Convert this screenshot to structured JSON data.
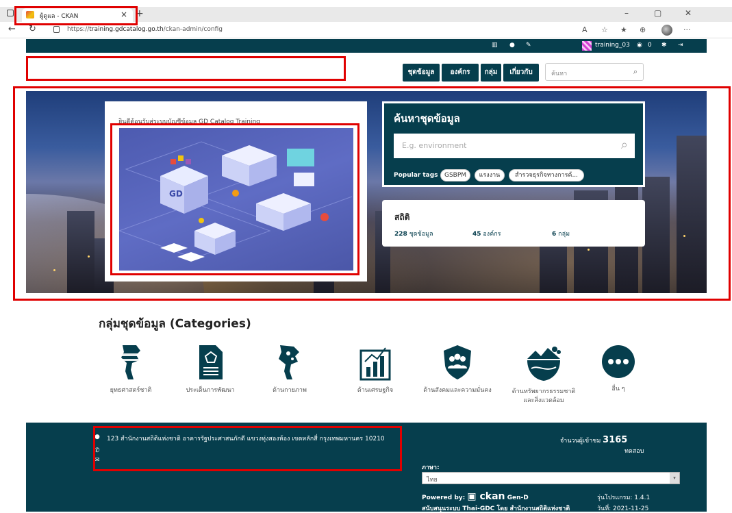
{
  "browser": {
    "tab_title": "ผู้ดูแล - CKAN",
    "url_prefix": "https://",
    "url_host": "training.gdcatalog.go.th",
    "url_path": "/ckan-admin/config"
  },
  "topbar": {
    "username": "training_03",
    "activity_count": "0"
  },
  "nav": {
    "items": [
      "ชุดข้อมูล",
      "องค์กร",
      "กลุ่ม",
      "เกี่ยวกับ"
    ],
    "search_placeholder": "ค้นหา"
  },
  "hero": {
    "welcome_text": "ยินดีต้อนรับสู่ระบบบัญชีข้อมูล GD Catalog Training",
    "search_title": "ค้นหาชุดข้อมูล",
    "search_placeholder": "E.g. environment",
    "popular_tags_label": "Popular tags",
    "tags": [
      "GSBPM",
      "แรงงาน",
      "สำรวจธุรกิจทางการค้..."
    ],
    "illustration_text": "GD"
  },
  "stats": {
    "title": "สถิติ",
    "datasets_count": "228",
    "datasets_label": "ชุดข้อมูล",
    "orgs_count": "45",
    "orgs_label": "องค์กร",
    "groups_count": "6",
    "groups_label": "กลุ่ม"
  },
  "categories": {
    "title": "กลุ่มชุดข้อมูล (Categories)",
    "items": [
      {
        "label": "ยุทธศาสตร์ชาติ",
        "icon": "thailand-flag-map-icon"
      },
      {
        "label": "ประเด็นการพัฒนา",
        "icon": "document-icon"
      },
      {
        "label": "ด้านกายภาพ",
        "icon": "thailand-map-icon"
      },
      {
        "label": "ด้านเศรษฐกิจ",
        "icon": "bar-chart-icon"
      },
      {
        "label": "ด้านสังคมและความมั่นคง",
        "icon": "people-shield-icon"
      },
      {
        "label": "ด้านทรัพยากรธรรมชาติ",
        "label2": "และสิ่งแวดล้อม",
        "icon": "nature-icon"
      },
      {
        "label": "อื่น ๆ",
        "icon": "more-icon"
      }
    ]
  },
  "footer": {
    "address": "123 สำนักงานสถิติแห่งชาติ อาคารรัฐประศาสนภักดี แขวงทุ่งสองห้อง เขตหลักสี่ กรุงเทพมหานคร 10210",
    "visits_label": "จำนวนผู้เข้าชม",
    "visits_count": "3165",
    "visits_sub": "ทดสอบ",
    "language_label": "ภาษา:",
    "language_value": "ไทย",
    "powered_by": "Powered by:",
    "powered_ckan": "ckan",
    "powered_gen": "Gen-D",
    "supported_by": "สนับสนุนระบบ Thai-GDC โดย สำนักงานสถิติแห่งชาติ",
    "version": "รุ่นโปรแกรม: 1.4.1",
    "date": "วันที่: 2021-11-25"
  },
  "colors": {
    "brand": "#063e4d",
    "highlight": "#e00000"
  }
}
